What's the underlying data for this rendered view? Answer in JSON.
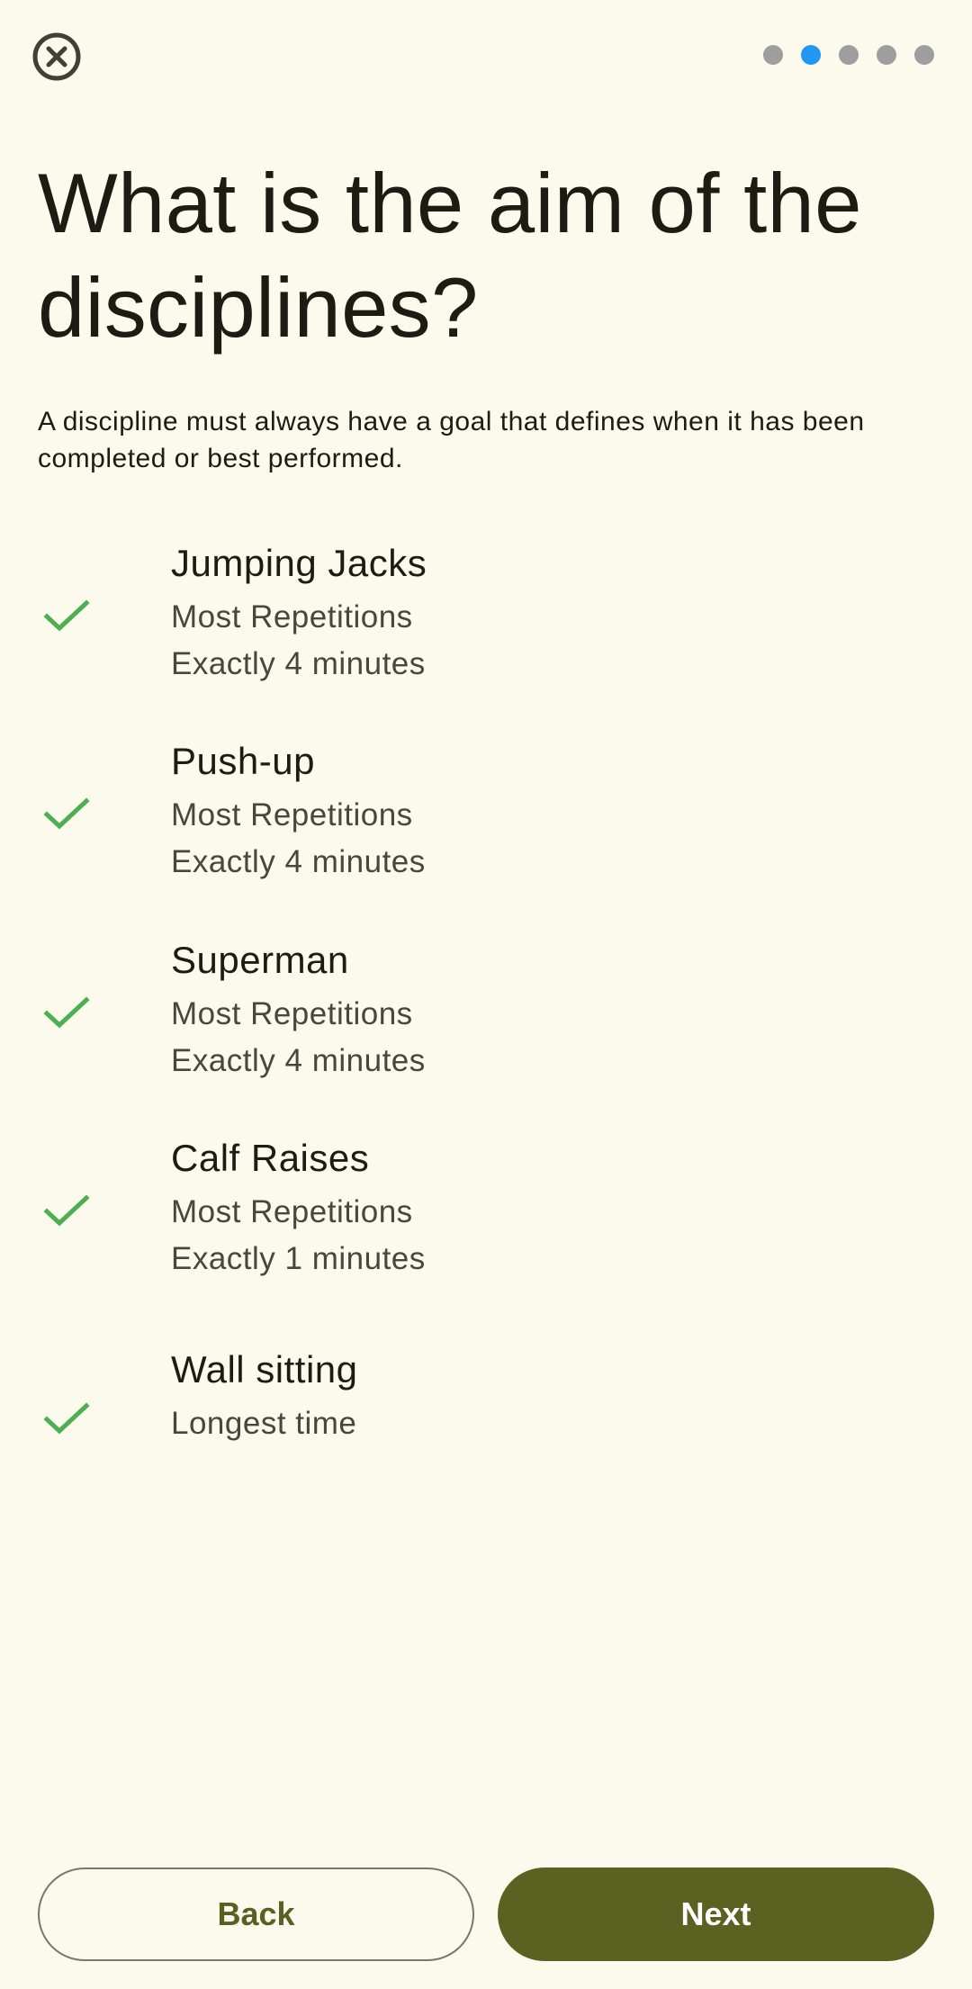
{
  "header": {
    "close_icon": "close-circle-icon",
    "steps": {
      "total": 5,
      "active_index": 1
    },
    "colors": {
      "active_dot": "#2196F3",
      "inactive_dot": "#9E9E9E"
    }
  },
  "main": {
    "title": "What is the aim of the disciplines?",
    "description": "A discipline must always have a goal that defines when it has been completed or best performed.",
    "disciplines": [
      {
        "name": "Jumping Jacks",
        "goal": "Most Repetitions",
        "duration": "Exactly 4 minutes",
        "icon": "check-icon"
      },
      {
        "name": "Push-up",
        "goal": "Most Repetitions",
        "duration": "Exactly 4 minutes",
        "icon": "check-icon"
      },
      {
        "name": "Superman",
        "goal": "Most Repetitions",
        "duration": "Exactly 4 minutes",
        "icon": "check-icon"
      },
      {
        "name": "Calf Raises",
        "goal": "Most Repetitions",
        "duration": "Exactly 1 minutes",
        "icon": "check-icon"
      },
      {
        "name": "Wall sitting",
        "goal": "Longest time",
        "icon": "check-icon"
      }
    ]
  },
  "footer": {
    "back_label": "Back",
    "next_label": "Next"
  },
  "colors": {
    "background": "#FCFAEC",
    "primary": "#5A6121",
    "check": "#4CAF50"
  }
}
